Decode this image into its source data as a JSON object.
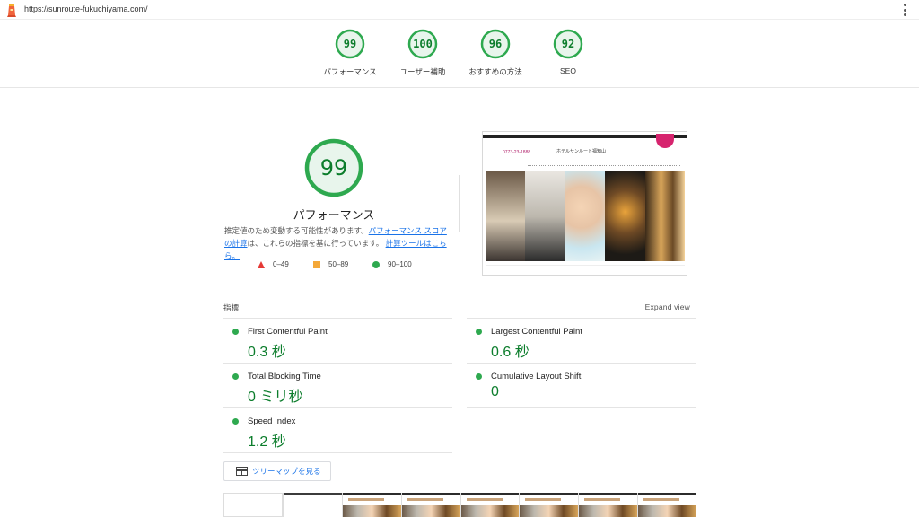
{
  "url": "https://sunroute-fukuchiyama.com/",
  "summary_gauges": [
    {
      "score": "99",
      "label": "パフォーマンス"
    },
    {
      "score": "100",
      "label": "ユーザー補助"
    },
    {
      "score": "96",
      "label": "おすすめの方法"
    },
    {
      "score": "92",
      "label": "SEO"
    }
  ],
  "performance": {
    "score": "99",
    "title": "パフォーマンス",
    "desc_prefix": "推定値のため変動する可能性があります。",
    "desc_link1": "パフォーマンス スコアの計算",
    "desc_middle": "は、これらの指標を基に行っています。",
    "desc_link2": "計算ツールはこちら。"
  },
  "legend": {
    "fail": "0–49",
    "average": "50–89",
    "pass": "90–100"
  },
  "colors": {
    "pass": "#0c7d2c",
    "pass_dot": "#2ea94f",
    "average": "#f4a838",
    "fail": "#e53935",
    "link": "#1a73e8"
  },
  "screenshot": {
    "phone": "0773-23-1888",
    "hotel_name": "ホテルサンルート福知山"
  },
  "metrics_header": "指標",
  "expand_label": "Expand view",
  "metrics": [
    {
      "name": "First Contentful Paint",
      "value": "0.3 秒"
    },
    {
      "name": "Largest Contentful Paint",
      "value": "0.6 秒"
    },
    {
      "name": "Total Blocking Time",
      "value": "0 ミリ秒"
    },
    {
      "name": "Cumulative Layout Shift",
      "value": "0"
    },
    {
      "name": "Speed Index",
      "value": "1.2 秒"
    }
  ],
  "treemap_label": "ツリーマップを見る",
  "icons": {
    "logo": "lighthouse-icon",
    "menu": "kebab-menu-icon",
    "treemap": "treemap-icon"
  }
}
